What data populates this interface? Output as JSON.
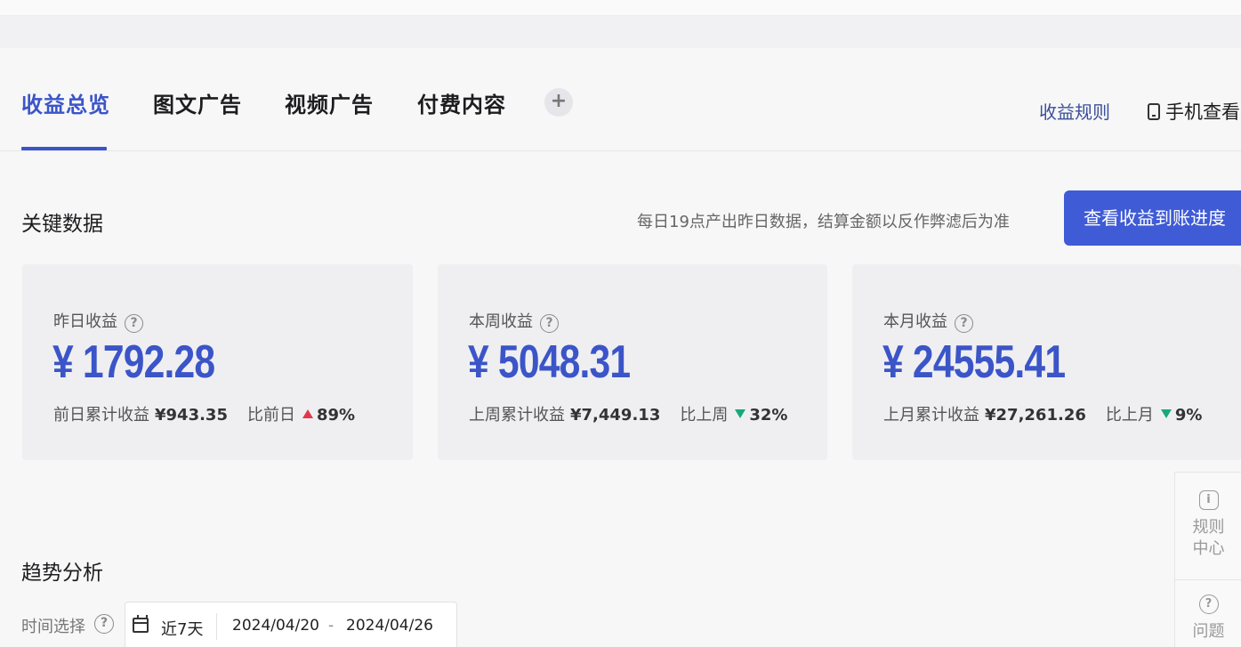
{
  "tabs": [
    {
      "label": "收益总览",
      "active": true
    },
    {
      "label": "图文广告",
      "active": false
    },
    {
      "label": "视频广告",
      "active": false
    },
    {
      "label": "付费内容",
      "active": false
    }
  ],
  "tab_add": "+",
  "header_links": {
    "rules": "收益规则",
    "mobile_view": "手机查看"
  },
  "key_data": {
    "title": "关键数据",
    "notice": "每日19点产出昨日数据，结算金额以反作弊滤后为准",
    "progress_button": "查看收益到账进度",
    "cards": [
      {
        "label": "昨日收益",
        "value": "¥ 1792.28",
        "prev_label": "前日累计收益",
        "prev_value": "¥943.35",
        "compare_label": "比前日",
        "trend": "up",
        "pct": "89%"
      },
      {
        "label": "本周收益",
        "value": "¥ 5048.31",
        "prev_label": "上周累计收益",
        "prev_value": "¥7,449.13",
        "compare_label": "比上周",
        "trend": "down",
        "pct": "32%"
      },
      {
        "label": "本月收益",
        "value": "¥ 24555.41",
        "prev_label": "上月累计收益",
        "prev_value": "¥27,261.26",
        "compare_label": "比上月",
        "trend": "down",
        "pct": "9%"
      }
    ]
  },
  "trend": {
    "title": "趋势分析",
    "time_label": "时间选择",
    "quick_range": "近7天",
    "start_date": "2024/04/20",
    "date_separator": "-",
    "end_date": "2024/04/26"
  },
  "side_panel": {
    "rules_center": "规则中心",
    "question": "问题"
  },
  "help_glyph": "?",
  "info_glyph": "i",
  "colors": {
    "accent": "#3b55c8",
    "button": "#3f5bd6",
    "up": "#e0384a",
    "down": "#18a87d"
  }
}
